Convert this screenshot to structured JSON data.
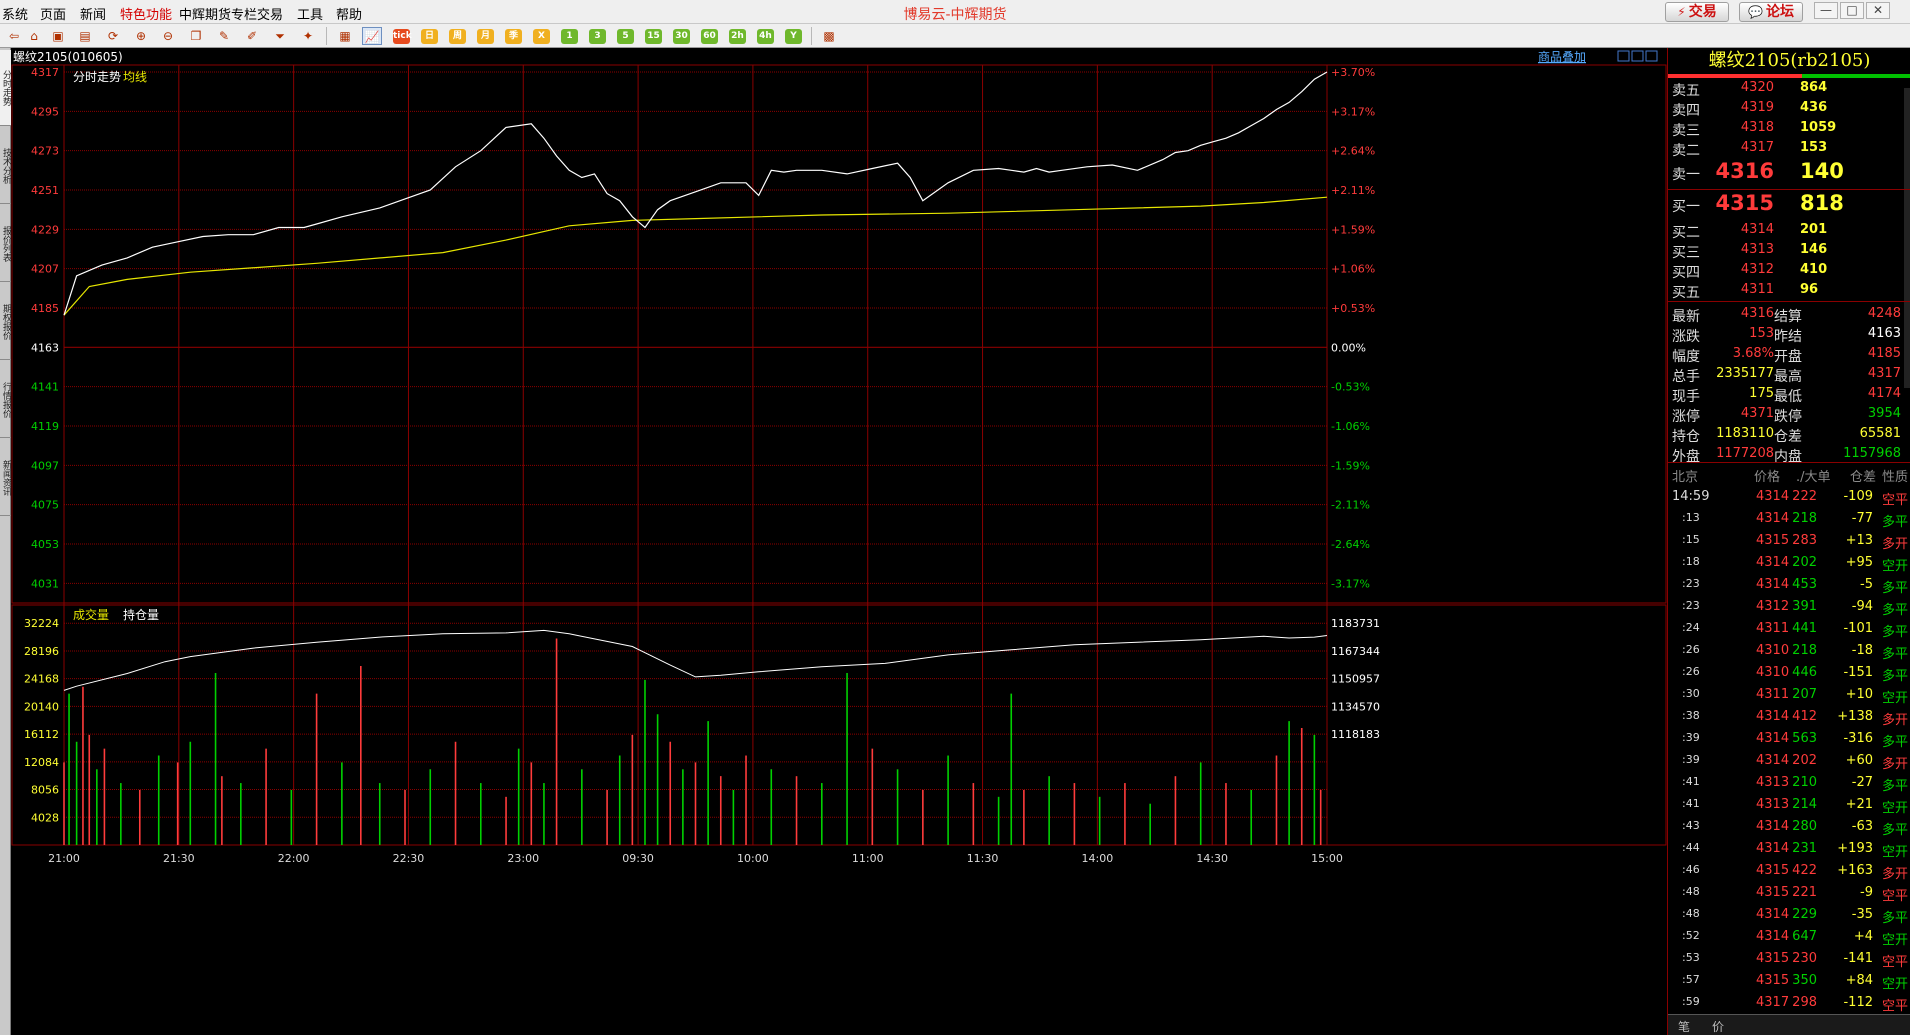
{
  "app": {
    "title": "博易云-中辉期货",
    "menu": [
      "系统",
      "页面",
      "新闻",
      "特色功能",
      "中辉期货专栏",
      "交易",
      "工具",
      "帮助"
    ],
    "trade_button": "交易",
    "forum_button": "论坛"
  },
  "toolbar": {
    "period_buttons": [
      "tick",
      "日",
      "周",
      "月",
      "季",
      "X",
      "1",
      "3",
      "5",
      "15",
      "30",
      "60",
      "2h",
      "4h",
      "Y"
    ]
  },
  "side_tabs": [
    "分时走势",
    "技术分析",
    "报价列表",
    "期权报价",
    "行情报价",
    "新闻资讯"
  ],
  "chart": {
    "instrument": "螺纹2105(010605)",
    "overlay_link": "商品叠加",
    "price_panel_labels": {
      "minute": "分时走势",
      "avg": "均线"
    },
    "volume_panel_labels": {
      "volume": "成交量",
      "oi": "持仓量"
    },
    "time_labels": [
      "21:00",
      "21:30",
      "22:00",
      "22:30",
      "23:00",
      "09:30",
      "10:00",
      "11:00",
      "11:30",
      "14:00",
      "14:30",
      "15:00"
    ],
    "colors": {
      "up": "#ff3b3b",
      "down": "#00d000",
      "grid": "#8a0000",
      "price_line": "#ffffff",
      "avg_line": "#e6e600"
    }
  },
  "chart_data": {
    "type": "line",
    "title": "螺纹2105(010605)",
    "x": [
      "21:00",
      "21:30",
      "22:00",
      "22:30",
      "23:00",
      "09:30",
      "10:00",
      "11:00",
      "11:30",
      "14:00",
      "14:30",
      "15:00"
    ],
    "prev_settle": 4163,
    "price_axis": {
      "ticks": [
        "4317",
        "4295",
        "4273",
        "4251",
        "4229",
        "4207",
        "4185",
        "4163",
        "4141",
        "4119",
        "4097",
        "4075",
        "4053",
        "4031"
      ],
      "pct_ticks": [
        "+3.70%",
        "+3.17%",
        "+2.64%",
        "+2.11%",
        "+1.59%",
        "+1.06%",
        "+0.53%",
        "0.00%",
        "-0.53%",
        "-1.06%",
        "-1.59%",
        "-2.11%",
        "-2.64%",
        "-3.17%"
      ],
      "ylim": [
        4020,
        4317
      ]
    },
    "series": [
      {
        "name": "分时走势",
        "x_frac": [
          0,
          0.01,
          0.03,
          0.05,
          0.07,
          0.09,
          0.11,
          0.13,
          0.15,
          0.17,
          0.19,
          0.2,
          0.22,
          0.25,
          0.27,
          0.29,
          0.31,
          0.33,
          0.35,
          0.37,
          0.38,
          0.39,
          0.4,
          0.41,
          0.42,
          0.43,
          0.44,
          0.45,
          0.46,
          0.47,
          0.48,
          0.5,
          0.52,
          0.54,
          0.55,
          0.56,
          0.57,
          0.58,
          0.6,
          0.62,
          0.64,
          0.66,
          0.67,
          0.68,
          0.7,
          0.72,
          0.74,
          0.75,
          0.76,
          0.77,
          0.78,
          0.79,
          0.81,
          0.83,
          0.85,
          0.87,
          0.88,
          0.89,
          0.9,
          0.91,
          0.92,
          0.93,
          0.94,
          0.95,
          0.96,
          0.97,
          0.98,
          0.99,
          1.0
        ],
        "values": [
          4181,
          4203,
          4209,
          4213,
          4219,
          4222,
          4225,
          4226,
          4226,
          4230,
          4230,
          4232,
          4236,
          4241,
          4246,
          4251,
          4264,
          4273,
          4286,
          4288,
          4280,
          4270,
          4262,
          4258,
          4260,
          4249,
          4245,
          4236,
          4230,
          4240,
          4245,
          4250,
          4255,
          4255,
          4248,
          4262,
          4261,
          4262,
          4262,
          4260,
          4263,
          4266,
          4258,
          4245,
          4255,
          4262,
          4263,
          4262,
          4261,
          4263,
          4261,
          4262,
          4264,
          4265,
          4262,
          4268,
          4272,
          4273,
          4276,
          4278,
          4280,
          4283,
          4287,
          4291,
          4296,
          4300,
          4306,
          4313,
          4317
        ]
      },
      {
        "name": "均线",
        "x_frac": [
          0,
          0.02,
          0.05,
          0.1,
          0.2,
          0.3,
          0.35,
          0.4,
          0.45,
          0.5,
          0.6,
          0.7,
          0.8,
          0.9,
          0.95,
          1.0
        ],
        "values": [
          4181,
          4197,
          4201,
          4205,
          4210,
          4216,
          4223,
          4231,
          4234,
          4235,
          4237,
          4238,
          4240,
          4242,
          4244,
          4247
        ]
      }
    ],
    "volume_axis": {
      "ticks": [
        "32224",
        "28196",
        "24168",
        "20140",
        "16112",
        "12084",
        "8056",
        "4028"
      ],
      "oi_ticks": [
        "1183731",
        "1167344",
        "1150957",
        "1134570",
        "1118183"
      ],
      "ylim": [
        0,
        34000
      ]
    },
    "open_interest": {
      "x_frac": [
        0,
        0.01,
        0.05,
        0.08,
        0.1,
        0.15,
        0.2,
        0.25,
        0.3,
        0.35,
        0.38,
        0.4,
        0.45,
        0.48,
        0.5,
        0.52,
        0.55,
        0.6,
        0.65,
        0.7,
        0.75,
        0.8,
        0.85,
        0.9,
        0.95,
        0.97,
        0.99,
        1.0
      ],
      "values": [
        1144000,
        1146500,
        1154000,
        1161000,
        1164000,
        1169000,
        1172500,
        1175500,
        1177500,
        1178000,
        1179500,
        1177500,
        1170000,
        1159000,
        1152000,
        1153000,
        1155000,
        1158000,
        1160000,
        1165000,
        1168000,
        1171000,
        1172500,
        1174000,
        1176000,
        1175000,
        1175500,
        1176500
      ]
    },
    "volume_bars": {
      "x_frac": [
        0,
        0.004,
        0.01,
        0.015,
        0.02,
        0.026,
        0.032,
        0.045,
        0.06,
        0.075,
        0.09,
        0.1,
        0.12,
        0.125,
        0.14,
        0.16,
        0.18,
        0.2,
        0.22,
        0.235,
        0.25,
        0.27,
        0.29,
        0.31,
        0.33,
        0.35,
        0.36,
        0.37,
        0.38,
        0.39,
        0.41,
        0.43,
        0.44,
        0.45,
        0.46,
        0.47,
        0.48,
        0.49,
        0.5,
        0.51,
        0.52,
        0.53,
        0.54,
        0.56,
        0.58,
        0.6,
        0.62,
        0.64,
        0.66,
        0.68,
        0.7,
        0.72,
        0.74,
        0.75,
        0.76,
        0.78,
        0.8,
        0.82,
        0.84,
        0.86,
        0.88,
        0.9,
        0.92,
        0.94,
        0.96,
        0.97,
        0.98,
        0.99,
        0.995
      ],
      "values": [
        12000,
        22000,
        15000,
        23000,
        16000,
        11000,
        14000,
        9000,
        8000,
        13000,
        12000,
        15000,
        25000,
        10000,
        9000,
        14000,
        8000,
        22000,
        12000,
        26000,
        9000,
        8000,
        11000,
        15000,
        9000,
        7000,
        14000,
        12000,
        9000,
        30000,
        11000,
        8000,
        13000,
        16000,
        24000,
        19000,
        15000,
        11000,
        12000,
        18000,
        10000,
        8000,
        13000,
        11000,
        10000,
        9000,
        25000,
        14000,
        11000,
        8000,
        13000,
        9000,
        7000,
        22000,
        8000,
        10000,
        9000,
        7000,
        9000,
        6000,
        10000,
        12000,
        9000,
        8000,
        13000,
        18000,
        17000,
        16000,
        8000
      ],
      "colors": [
        "r",
        "g",
        "g",
        "r",
        "r",
        "g",
        "r",
        "g",
        "r",
        "g",
        "r",
        "g",
        "g",
        "r",
        "g",
        "r",
        "g",
        "r",
        "g",
        "r",
        "g",
        "r",
        "g",
        "r",
        "g",
        "r",
        "g",
        "r",
        "g",
        "r",
        "g",
        "r",
        "g",
        "r",
        "g",
        "g",
        "r",
        "g",
        "r",
        "g",
        "r",
        "g",
        "r",
        "g",
        "r",
        "g",
        "g",
        "r",
        "g",
        "r",
        "g",
        "r",
        "g",
        "g",
        "r",
        "g",
        "r",
        "g",
        "r",
        "g",
        "r",
        "g",
        "r",
        "g",
        "r",
        "g",
        "r",
        "g",
        "r"
      ]
    },
    "grid": true
  },
  "quote": {
    "title": "螺纹2105(rb2105)",
    "asks": [
      {
        "label": "卖五",
        "price": "4320",
        "vol": "864"
      },
      {
        "label": "卖四",
        "price": "4319",
        "vol": "436"
      },
      {
        "label": "卖三",
        "price": "4318",
        "vol": "1059"
      },
      {
        "label": "卖二",
        "price": "4317",
        "vol": "153"
      },
      {
        "label": "卖一",
        "price": "4316",
        "vol": "140"
      }
    ],
    "bids": [
      {
        "label": "买一",
        "price": "4315",
        "vol": "818"
      },
      {
        "label": "买二",
        "price": "4314",
        "vol": "201"
      },
      {
        "label": "买三",
        "price": "4313",
        "vol": "146"
      },
      {
        "label": "买四",
        "price": "4312",
        "vol": "410"
      },
      {
        "label": "买五",
        "price": "4311",
        "vol": "96"
      }
    ],
    "stats": [
      {
        "l1": "最新",
        "v1": "4316",
        "c1": "#ff3b3b",
        "l2": "结算",
        "v2": "4248",
        "c2": "#ff3b3b"
      },
      {
        "l1": "涨跌",
        "v1": "153",
        "c1": "#ff3b3b",
        "l2": "昨结",
        "v2": "4163",
        "c2": "#ffffff"
      },
      {
        "l1": "幅度",
        "v1": "3.68%",
        "c1": "#ff3b3b",
        "l2": "开盘",
        "v2": "4185",
        "c2": "#ff3b3b"
      },
      {
        "l1": "总手",
        "v1": "2335177",
        "c1": "#ffff33",
        "l2": "最高",
        "v2": "4317",
        "c2": "#ff3b3b"
      },
      {
        "l1": "现手",
        "v1": "175",
        "c1": "#ffff33",
        "l2": "最低",
        "v2": "4174",
        "c2": "#ff3b3b"
      },
      {
        "l1": "涨停",
        "v1": "4371",
        "c1": "#ff3b3b",
        "l2": "跌停",
        "v2": "3954",
        "c2": "#00d000"
      },
      {
        "l1": "持仓",
        "v1": "1183110",
        "c1": "#ffff33",
        "l2": "仓差",
        "v2": "65581",
        "c2": "#ffff33"
      },
      {
        "l1": "外盘",
        "v1": "1177208",
        "c1": "#ff3b3b",
        "l2": "内盘",
        "v2": "1157968",
        "c2": "#00d000"
      }
    ],
    "ticks_header": {
      "time": "北京",
      "price": "价格",
      "vol": "./大单",
      "oi": "仓差",
      "type": "性质"
    },
    "ticks": [
      {
        "t": "14:59",
        "p": "4314",
        "v": "222",
        "d": "-109",
        "k": "空平"
      },
      {
        "t": ":13",
        "p": "4314",
        "v": "218",
        "d": "-77",
        "k": "多平"
      },
      {
        "t": ":15",
        "p": "4315",
        "v": "283",
        "d": "+13",
        "k": "多开"
      },
      {
        "t": ":18",
        "p": "4314",
        "v": "202",
        "d": "+95",
        "k": "空开"
      },
      {
        "t": ":23",
        "p": "4314",
        "v": "453",
        "d": "-5",
        "k": "多平"
      },
      {
        "t": ":23",
        "p": "4312",
        "v": "391",
        "d": "-94",
        "k": "多平"
      },
      {
        "t": ":24",
        "p": "4311",
        "v": "441",
        "d": "-101",
        "k": "多平"
      },
      {
        "t": ":26",
        "p": "4310",
        "v": "218",
        "d": "-18",
        "k": "多平"
      },
      {
        "t": ":26",
        "p": "4310",
        "v": "446",
        "d": "-151",
        "k": "多平"
      },
      {
        "t": ":30",
        "p": "4311",
        "v": "207",
        "d": "+10",
        "k": "空开"
      },
      {
        "t": ":38",
        "p": "4314",
        "v": "412",
        "d": "+138",
        "k": "多开"
      },
      {
        "t": ":39",
        "p": "4314",
        "v": "563",
        "d": "-316",
        "k": "多平"
      },
      {
        "t": ":39",
        "p": "4314",
        "v": "202",
        "d": "+60",
        "k": "多开"
      },
      {
        "t": ":41",
        "p": "4313",
        "v": "210",
        "d": "-27",
        "k": "多平"
      },
      {
        "t": ":41",
        "p": "4313",
        "v": "214",
        "d": "+21",
        "k": "空开"
      },
      {
        "t": ":43",
        "p": "4314",
        "v": "280",
        "d": "-63",
        "k": "多平"
      },
      {
        "t": ":44",
        "p": "4314",
        "v": "231",
        "d": "+193",
        "k": "空开"
      },
      {
        "t": ":46",
        "p": "4315",
        "v": "422",
        "d": "+163",
        "k": "多开"
      },
      {
        "t": ":48",
        "p": "4315",
        "v": "221",
        "d": "-9",
        "k": "空平"
      },
      {
        "t": ":48",
        "p": "4314",
        "v": "229",
        "d": "-35",
        "k": "多平"
      },
      {
        "t": ":52",
        "p": "4314",
        "v": "647",
        "d": "+4",
        "k": "空开"
      },
      {
        "t": ":53",
        "p": "4315",
        "v": "230",
        "d": "-141",
        "k": "空平"
      },
      {
        "t": ":57",
        "p": "4315",
        "v": "350",
        "d": "+84",
        "k": "空开"
      },
      {
        "t": ":59",
        "p": "4317",
        "v": "298",
        "d": "-112",
        "k": "空平"
      }
    ],
    "bottom_tabs": [
      "笔",
      "价"
    ]
  }
}
